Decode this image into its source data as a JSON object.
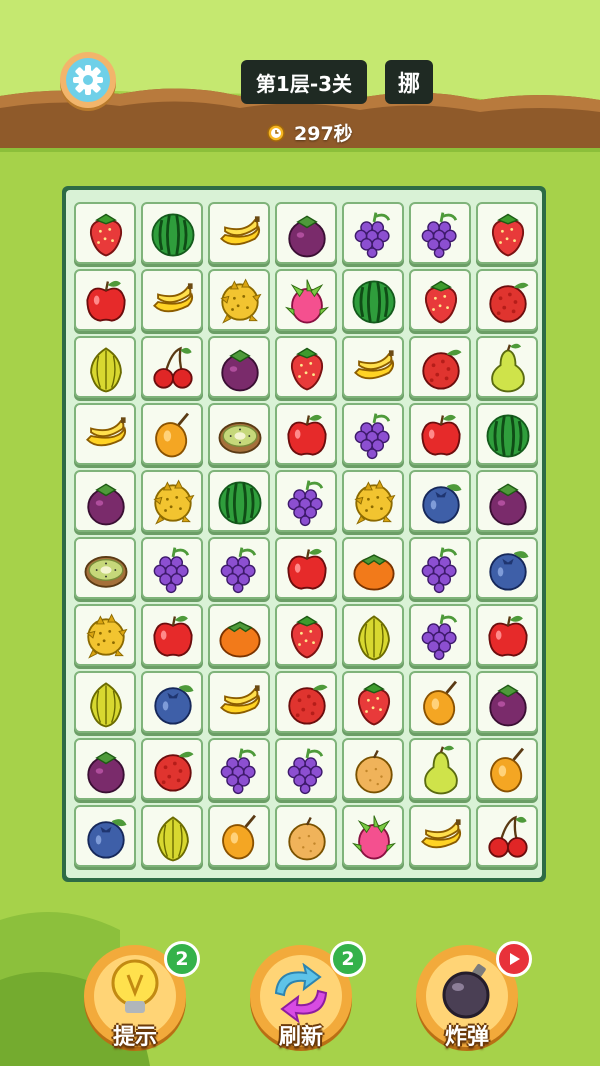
{
  "header": {
    "level_label": "第1层-3关",
    "shuffle_label": "挪",
    "timer_text": "297秒"
  },
  "board": {
    "rows": [
      [
        "strawberry",
        "watermelon",
        "banana",
        "mangosteen",
        "grape",
        "grape",
        "strawberry"
      ],
      [
        "apple",
        "banana",
        "durian",
        "dragonfruit",
        "watermelon",
        "strawberry",
        "lychee"
      ],
      [
        "starfruit",
        "cherry",
        "mangosteen",
        "strawberry",
        "banana",
        "lychee",
        "pear"
      ],
      [
        "banana",
        "loquat",
        "kiwi",
        "apple",
        "grape",
        "apple",
        "watermelon"
      ],
      [
        "mangosteen",
        "durian",
        "watermelon",
        "grape",
        "durian",
        "blueberry",
        "mangosteen"
      ],
      [
        "kiwi",
        "grape",
        "grape",
        "apple",
        "persimmon",
        "grape",
        "blueberry"
      ],
      [
        "durian",
        "apple",
        "persimmon",
        "strawberry",
        "starfruit",
        "grape",
        "apple"
      ],
      [
        "starfruit",
        "blueberry",
        "banana",
        "lychee",
        "strawberry",
        "loquat",
        "mangosteen"
      ],
      [
        "mangosteen",
        "lychee",
        "grape",
        "grape",
        "orange",
        "pear",
        "loquat"
      ],
      [
        "blueberry",
        "starfruit",
        "loquat",
        "orange",
        "dragonfruit",
        "banana",
        "cherry"
      ]
    ]
  },
  "powerups": [
    {
      "label": "提示",
      "count": "2",
      "icon": "lightbulb-icon"
    },
    {
      "label": "刷新",
      "count": "2",
      "icon": "refresh-icon"
    },
    {
      "label": "炸弹",
      "count": "",
      "icon": "bomb-icon",
      "badge_icon": "play-icon"
    }
  ],
  "colors": {
    "grass": "#a6d24a",
    "board_border": "#2d6b45",
    "tile_bg": "#f7fbef",
    "powerup_ring": "#f2aa3b"
  }
}
